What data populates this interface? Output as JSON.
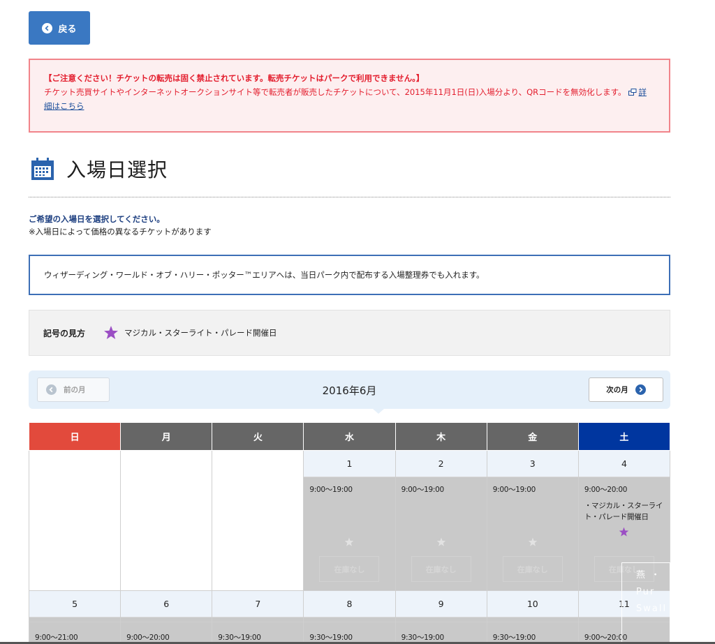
{
  "back_button": {
    "label": "戻る"
  },
  "warning": {
    "heading": "【ご注意ください！チケットの転売は固く禁止されています。転売チケットはパークで利用できません。】",
    "body": "チケット売買サイトやインターネットオークションサイト等で転売者が販売したチケットについて、2015年11月1日(日)入場分より、QRコードを無効化します。",
    "link": "詳細はこちら"
  },
  "page_title": "入場日選択",
  "lead": {
    "instruction": "ご希望の入場日を選択してください。",
    "note": "※入場日によって価格の異なるチケットがあります"
  },
  "notice": "ウィザーディング・ワールド・オブ・ハリー・ポッター™エリアへは、当日パーク内で配布する入場整理券でも入れます。",
  "legend": {
    "label": "記号の見方",
    "text": "マジカル・スターライト・パレード開催日"
  },
  "calendar": {
    "month_title": "2016年6月",
    "prev_label": "前の月",
    "next_label": "次の月",
    "weekdays": [
      "日",
      "月",
      "火",
      "水",
      "木",
      "金",
      "土"
    ],
    "week1": [
      {
        "day": "1",
        "hours": "9:00〜19:00",
        "event": "",
        "oos": "在庫なし"
      },
      {
        "day": "2",
        "hours": "9:00〜19:00",
        "event": "",
        "oos": "在庫なし"
      },
      {
        "day": "3",
        "hours": "9:00〜19:00",
        "event": "",
        "oos": "在庫なし"
      },
      {
        "day": "4",
        "hours": "9:00〜20:00",
        "event": "・マジカル・スターライト・パレード開催日",
        "oos": "在庫なし"
      }
    ],
    "week2": [
      {
        "day": "5",
        "hours": "9:00〜21:00"
      },
      {
        "day": "6",
        "hours": "9:00〜20:00"
      },
      {
        "day": "7",
        "hours": "9:30〜19:00"
      },
      {
        "day": "8",
        "hours": "9:30〜19:00"
      },
      {
        "day": "9",
        "hours": "9:30〜19:00"
      },
      {
        "day": "10",
        "hours": "9:30〜19:00"
      },
      {
        "day": "11",
        "hours": "9:00〜20:00"
      }
    ]
  },
  "watermark": {
    "line1": "燕 ・",
    "line2": "Pur",
    "line3": "Swall"
  },
  "colors": {
    "sunday_header": "#e24a3c",
    "weekday_header": "#666666",
    "saturday_header": "#00369f",
    "star_active": "#9b4fc4",
    "star_inactive": "#e2e2e2",
    "accent_blue": "#3a78c2"
  }
}
